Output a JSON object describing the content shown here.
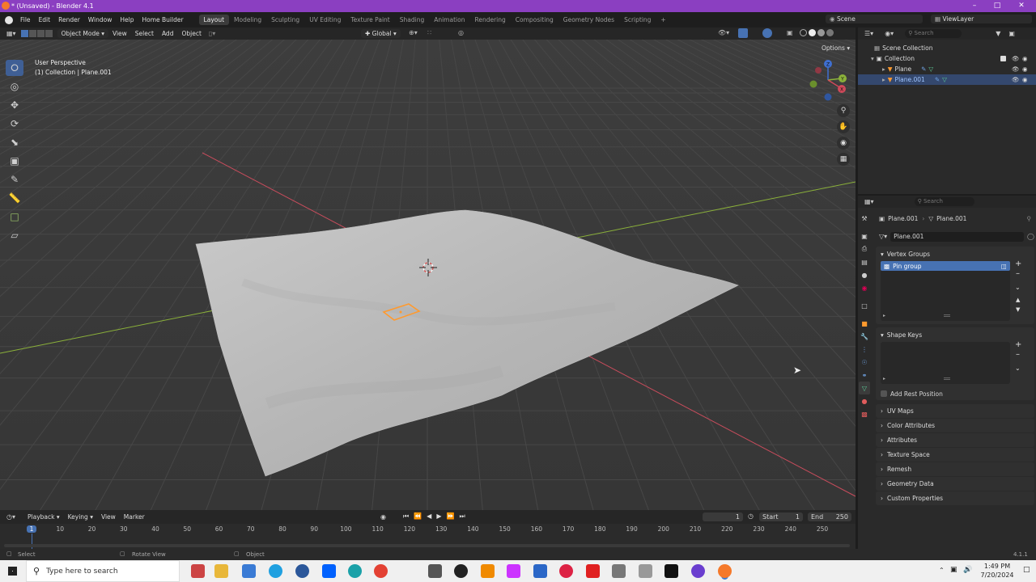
{
  "window": {
    "title": "* (Unsaved) - Blender 4.1"
  },
  "menu": {
    "items": [
      "File",
      "Edit",
      "Render",
      "Window",
      "Help",
      "Home Builder"
    ]
  },
  "workspaces": [
    "Layout",
    "Modeling",
    "Sculpting",
    "UV Editing",
    "Texture Paint",
    "Shading",
    "Animation",
    "Rendering",
    "Compositing",
    "Geometry Nodes",
    "Scripting"
  ],
  "scene": {
    "name": "Scene",
    "view_layer": "ViewLayer"
  },
  "viewport_header": {
    "mode": "Object Mode",
    "menus": [
      "View",
      "Select",
      "Add",
      "Object"
    ],
    "orientation": "Global",
    "options_label": "Options"
  },
  "viewport": {
    "perspective": "User Perspective",
    "context": "(1) Collection | Plane.001",
    "gizmo": {
      "x": "X",
      "y": "Y",
      "z": "Z"
    }
  },
  "outliner": {
    "search_placeholder": "Search",
    "root": "Scene Collection",
    "collection": "Collection",
    "items": [
      "Plane",
      "Plane.001"
    ]
  },
  "properties": {
    "search_placeholder": "Search",
    "breadcrumb_object": "Plane.001",
    "breadcrumb_mesh": "Plane.001",
    "mesh_name": "Plane.001",
    "vertex_groups_title": "Vertex Groups",
    "vertex_group_item": "Pin group",
    "shape_keys_title": "Shape Keys",
    "add_rest_position": "Add Rest Position",
    "collapsed_sections": [
      "UV Maps",
      "Color Attributes",
      "Attributes",
      "Texture Space",
      "Remesh",
      "Geometry Data",
      "Custom Properties"
    ]
  },
  "timeline": {
    "menus": [
      "Playback",
      "Keying",
      "View",
      "Marker"
    ],
    "current_frame": "1",
    "start_label": "Start",
    "start": "1",
    "end_label": "End",
    "end": "250",
    "ruler": [
      "1",
      "10",
      "20",
      "30",
      "40",
      "50",
      "60",
      "70",
      "80",
      "90",
      "100",
      "110",
      "120",
      "130",
      "140",
      "150",
      "160",
      "170",
      "180",
      "190",
      "200",
      "210",
      "220",
      "230",
      "240",
      "250"
    ]
  },
  "statusbar": {
    "select": "Select",
    "rotate": "Rotate View",
    "object": "Object",
    "version": "4.1.1"
  },
  "taskbar": {
    "search_placeholder": "Type here to search",
    "time": "1:49 PM",
    "date": "7/20/2024"
  },
  "colors": {
    "accent": "#4772b3",
    "title_bar": "#8b3fc1",
    "selection": "#ff9a2e",
    "x_axis": "#c84c5c",
    "y_axis": "#8bb13a"
  }
}
